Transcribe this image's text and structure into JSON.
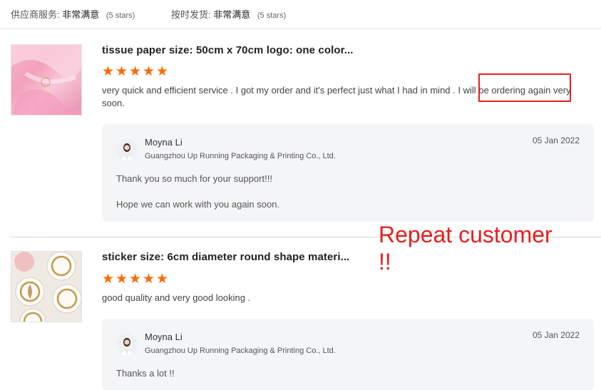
{
  "summary": {
    "supplier_service_label": "供应商服务:",
    "supplier_service_value": "非常满意",
    "supplier_service_stars": "(5 stars)",
    "shipping_label": "按时发货:",
    "shipping_value": "非常满意",
    "shipping_stars": "(5 stars)"
  },
  "reviews": [
    {
      "title": "tissue paper size: 50cm x 70cm logo: one color...",
      "rating": 5,
      "text": "very quick and efficient service . I got my order  and it's perfect just what I had in mind . I will be ordering again very soon.",
      "reply": {
        "name": "Moyna Li",
        "company": "Guangzhou Up Running Packaging & Printing Co., Ltd.",
        "date": "05 Jan 2022",
        "lines": [
          "Thank you so much for your support!!!",
          "Hope we can work with you again soon."
        ]
      }
    },
    {
      "title": "sticker size: 6cm diameter round shape materi...",
      "rating": 5,
      "text": "good quality and very good looking .",
      "reply": {
        "name": "Moyna Li",
        "company": "Guangzhou Up Running Packaging & Printing Co., Ltd.",
        "date": "05 Jan 2022",
        "lines": [
          "Thanks a lot !!"
        ]
      }
    }
  ],
  "annotation": {
    "text": "Repeat customer\n!!",
    "color": "#e5201e"
  },
  "colors": {
    "star": "#ff6a00",
    "reply_bg": "#f4f5f7",
    "highlight": "#e5201e"
  },
  "icons": {
    "star": "star-icon",
    "avatar": "avatar"
  }
}
